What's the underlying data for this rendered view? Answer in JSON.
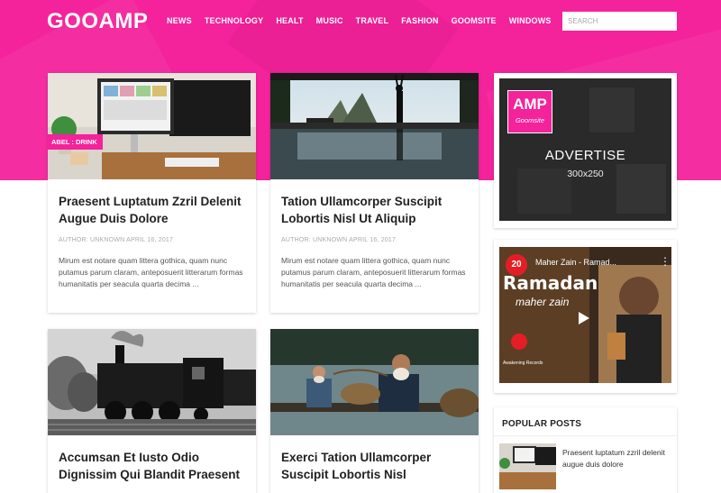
{
  "site": {
    "logo": "GOOAMP"
  },
  "nav": [
    "NEWS",
    "TECHNOLOGY",
    "HEALT",
    "MUSIC",
    "TRAVEL",
    "FASHION",
    "GOOMSITE",
    "WINDOWS"
  ],
  "search": {
    "placeholder": "SEARCH"
  },
  "posts": [
    {
      "label": "ABEL : DRINK",
      "title": "Praesent Luptatum Zzril Delenit Augue Duis Dolore",
      "author": "AUTHOR: UNKNOWN",
      "date": "APRIL 16, 2017",
      "excerpt": "Mirum est notare quam littera gothica, quam nunc putamus parum claram, anteposuerit litterarum formas humanitatis per seacula quarta decima ..."
    },
    {
      "title": "Tation Ullamcorper Suscipit Lobortis Nisl Ut Aliquip",
      "author": "AUTHOR: UNKNOWN",
      "date": "APRIL 16, 2017",
      "excerpt": "Mirum est notare quam littera gothica, quam nunc putamus parum claram, anteposuerit litterarum formas humanitatis per seacula quarta decima ..."
    },
    {
      "title": "Accumsan Et Iusto Odio Dignissim Qui Blandit Praesent"
    },
    {
      "title": "Exerci Tation Ullamcorper Suscipit Lobortis Nisl"
    }
  ],
  "ad": {
    "logo_main": "AMP",
    "logo_sub": "Goomsite",
    "text": "ADVERTISE",
    "size": "300x250"
  },
  "video": {
    "badge": "20",
    "title": "Maher Zain - Ramad...",
    "more": "⋮",
    "overlay_title": "Ramadan",
    "overlay_artist": "maher zain",
    "channel": "Awakening Records"
  },
  "popular": {
    "title": "POPULAR POSTS",
    "items": [
      {
        "title": "Praesent luptatum zzril delenit augue duis dolore"
      }
    ]
  },
  "colors": {
    "brand": "#f4229b",
    "text": "#222222",
    "muted": "#aaaaaa"
  }
}
